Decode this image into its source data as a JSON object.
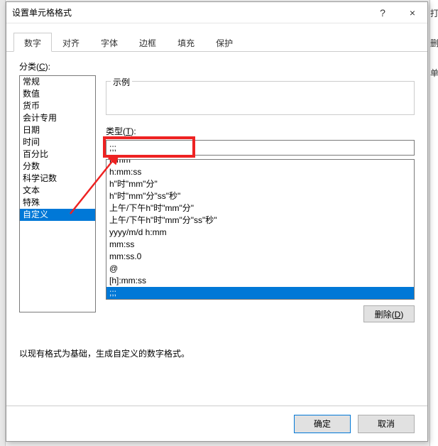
{
  "titlebar": {
    "title": "设置单元格格式",
    "help": "?",
    "close": "×"
  },
  "tabs": [
    {
      "label": "数字",
      "active": true
    },
    {
      "label": "对齐",
      "active": false
    },
    {
      "label": "字体",
      "active": false
    },
    {
      "label": "边框",
      "active": false
    },
    {
      "label": "填充",
      "active": false
    },
    {
      "label": "保护",
      "active": false
    }
  ],
  "category": {
    "label_prefix": "分类(",
    "label_hotkey": "C",
    "label_suffix": "):",
    "items": [
      "常规",
      "数值",
      "货币",
      "会计专用",
      "日期",
      "时间",
      "百分比",
      "分数",
      "科学记数",
      "文本",
      "特殊",
      "自定义"
    ],
    "selected_index": 11
  },
  "sample": {
    "label": "示例"
  },
  "type": {
    "label_prefix": "类型(",
    "label_hotkey": "T",
    "label_suffix": "):",
    "value": ";;;"
  },
  "formats": {
    "items": [
      "h:mm",
      "h:mm:ss",
      "h\"时\"mm\"分\"",
      "h\"时\"mm\"分\"ss\"秒\"",
      "上午/下午h\"时\"mm\"分\"",
      "上午/下午h\"时\"mm\"分\"ss\"秒\"",
      "yyyy/m/d h:mm",
      "mm:ss",
      "mm:ss.0",
      "@",
      "[h]:mm:ss",
      ";;;"
    ],
    "selected_index": 11
  },
  "delete_button": {
    "label_prefix": "删除(",
    "label_hotkey": "D",
    "label_suffix": ")"
  },
  "hint": "以现有格式为基础，生成自定义的数字格式。",
  "footer": {
    "ok": "确定",
    "cancel": "取消"
  },
  "right_strip": {
    "c1": "打",
    "c2": "删",
    "c3": "单"
  }
}
